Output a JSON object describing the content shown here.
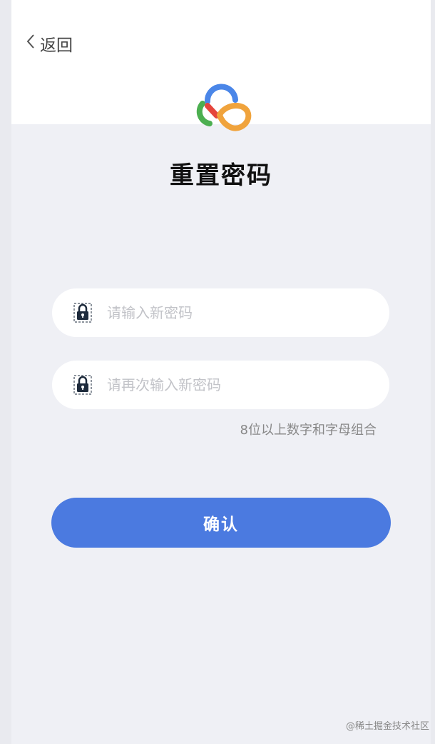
{
  "header": {
    "back_label": "返回"
  },
  "page": {
    "title": "重置密码"
  },
  "form": {
    "new_password": {
      "placeholder": "请输入新密码",
      "value": ""
    },
    "confirm_password": {
      "placeholder": "请再次输入新密码",
      "value": ""
    },
    "hint": "8位以上数字和字母组合",
    "confirm_label": "确认"
  },
  "footer": {
    "watermark": "@稀土掘金技术社区"
  },
  "colors": {
    "primary": "#4b7ae0",
    "background": "#eff0f5",
    "logo_blue": "#4a86e8",
    "logo_green": "#4caf50",
    "logo_red": "#e5453c",
    "logo_orange": "#f0a33c"
  },
  "icons": [
    "chevron-left-icon",
    "app-logo",
    "lock-icon"
  ]
}
